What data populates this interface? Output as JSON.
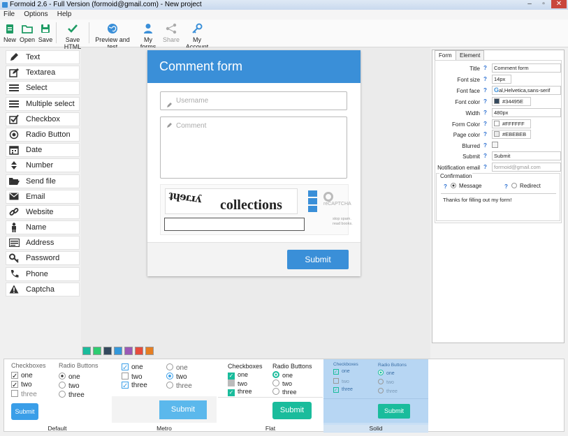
{
  "window": {
    "title": "Formoid 2.6 - Full Version (formoid@gmail.com) - New project",
    "min": "–",
    "max": "▫",
    "close": "✕"
  },
  "menu": [
    "File",
    "Options",
    "Help"
  ],
  "toolbar": {
    "new": "New",
    "open": "Open",
    "save": "Save",
    "save_html": "Save HTML",
    "preview": "Preview and test",
    "my_forms": "My forms",
    "share": "Share",
    "my_account": "My Account"
  },
  "palette": [
    "Text",
    "Textarea",
    "Select",
    "Multiple select",
    "Checkbox",
    "Radio Button",
    "Date",
    "Number",
    "Send file",
    "Email",
    "Website",
    "Name",
    "Address",
    "Password",
    "Phone",
    "Captcha"
  ],
  "form": {
    "title": "Comment form",
    "username_placeholder": "Username",
    "comment_placeholder": "Comment",
    "captcha_text_1": "ʇɥɘɾɹʎ",
    "captcha_text_2": "collections",
    "captcha_brand": "reCAPTCHA",
    "captcha_note": "stop spam. read books.",
    "submit": "Submit"
  },
  "props": {
    "tabs": [
      "Form",
      "Element"
    ],
    "rows": [
      {
        "label": "Title",
        "value": "Comment form"
      },
      {
        "label": "Font size",
        "value": "14px"
      },
      {
        "label": "Font face",
        "value": "al,Helvetica,sans-serif"
      },
      {
        "label": "Font color",
        "value": "#34495E"
      },
      {
        "label": "Width",
        "value": "480px"
      },
      {
        "label": "Form Color",
        "value": "#FFFFFF"
      },
      {
        "label": "Page color",
        "value": "#EBEBEB"
      },
      {
        "label": "Blurred",
        "value": ""
      },
      {
        "label": "Submit",
        "value": "Submit"
      },
      {
        "label": "Notification email",
        "value": "formoid@gmail.com"
      }
    ],
    "confirmation_label": "Confirmation",
    "message_label": "Message",
    "redirect_label": "Redirect",
    "confirmation_text": "Thanks for filling out my form!",
    "colors": {
      "font": "#34495E",
      "form": "#FFFFFF",
      "page": "#EBEBEB"
    }
  },
  "swatch_colors": [
    "#1abc9c",
    "#2ecc71",
    "#34495e",
    "#3498db",
    "#9b59b6",
    "#e74c3c",
    "#e67e22"
  ],
  "themes": {
    "checkboxes": "Checkboxes",
    "radio_buttons": "Radio Buttons",
    "items": [
      "one",
      "two",
      "three"
    ],
    "submit": "Submit",
    "names": [
      "Default",
      "Metro",
      "Flat",
      "Solid"
    ]
  }
}
